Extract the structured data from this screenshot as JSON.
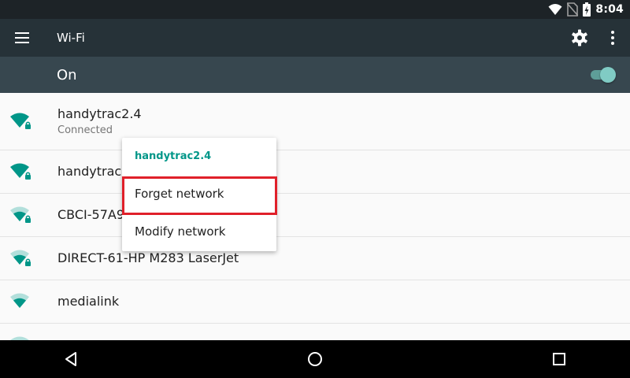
{
  "status_bar": {
    "time": "8:04",
    "icons": [
      "wifi-signal-icon",
      "no-sim-icon",
      "battery-charging-icon"
    ]
  },
  "app_bar": {
    "title": "Wi-Fi",
    "icons": [
      "menu-icon",
      "settings-gear-icon",
      "overflow-menu-icon"
    ]
  },
  "wifi_toggle": {
    "label": "On",
    "enabled": true,
    "accent_color": "#80cbc4"
  },
  "networks": [
    {
      "name": "handytrac2.4",
      "status": "Connected",
      "secured": true,
      "signal": "full"
    },
    {
      "name": "handytrac2",
      "status": "",
      "secured": true,
      "signal": "full"
    },
    {
      "name": "CBCI-57A9",
      "status": "",
      "secured": true,
      "signal": "medium"
    },
    {
      "name": "DIRECT-61-HP M283 LaserJet",
      "status": "",
      "secured": true,
      "signal": "medium"
    },
    {
      "name": "medialink",
      "status": "",
      "secured": false,
      "signal": "medium"
    }
  ],
  "context_menu": {
    "title": "handytrac2.4",
    "items": [
      "Forget network",
      "Modify network"
    ],
    "highlighted_item": "Forget network",
    "title_color": "#009688",
    "highlight_color": "#e0202a"
  },
  "nav_bar": {
    "icons": [
      "back-icon",
      "home-icon",
      "recents-icon"
    ]
  },
  "colors": {
    "status_bar": "#1d2327",
    "app_bar": "#263238",
    "toggle_bar": "#37474f",
    "wifi_icon": "#009688"
  }
}
